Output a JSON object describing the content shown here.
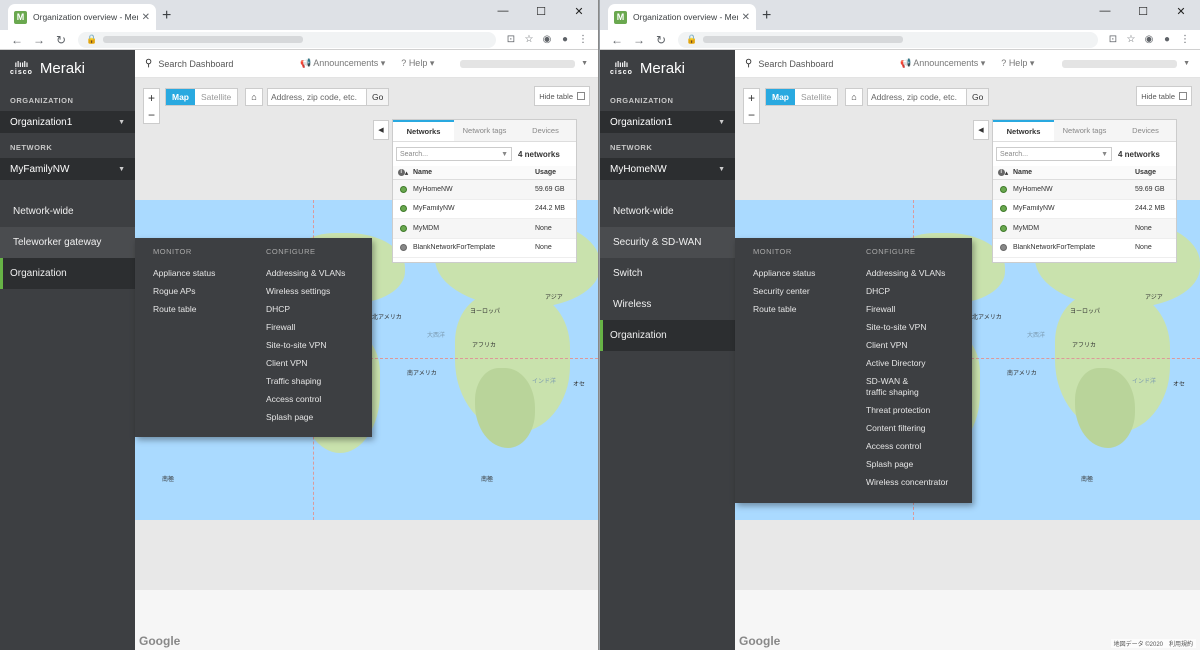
{
  "windows": [
    {
      "tab_title": "Organization overview - Meraki D",
      "favicon": "M",
      "window_controls": {
        "minimize": "—",
        "maximize": "☐",
        "close": "✕"
      },
      "org_label": "ORGANIZATION",
      "org_value": "Organization1",
      "net_label": "NETWORK",
      "net_value": "MyFamilyNW",
      "brand": "Meraki",
      "cisco": "cisco",
      "menu": [
        {
          "label": "Network-wide",
          "state": "normal"
        },
        {
          "label": "Teleworker gateway",
          "state": "hover"
        },
        {
          "label": "Organization",
          "state": "active"
        }
      ],
      "search_dashboard": "Search Dashboard",
      "announcements": "Announcements",
      "help": "Help",
      "map_btn": "Map",
      "satellite_btn": "Satellite",
      "address_placeholder": "Address, zip code, etc.",
      "go": "Go",
      "hide_table": "Hide table",
      "tabs": [
        "Networks",
        "Network tags",
        "Devices"
      ],
      "net_search": "Search...",
      "net_count": "4 networks",
      "col_name": "Name",
      "col_usage": "Usage",
      "networks": [
        {
          "name": "MyHomeNW",
          "usage": "59.69 GB",
          "status": "online"
        },
        {
          "name": "MyFamilyNW",
          "usage": "244.2 MB",
          "status": "online"
        },
        {
          "name": "MyMDM",
          "usage": "None",
          "status": "online"
        },
        {
          "name": "BlankNetworkForTemplate",
          "usage": "None",
          "status": "offline"
        }
      ],
      "flyout": {
        "monitor_title": "MONITOR",
        "configure_title": "CONFIGURE",
        "monitor": [
          "Appliance status",
          "Rogue APs",
          "Route table"
        ],
        "configure": [
          "Addressing & VLANs",
          "Wireless settings",
          "DHCP",
          "Firewall",
          "Site-to-site VPN",
          "Client VPN",
          "Traffic shaping",
          "Access control",
          "Splash page"
        ]
      },
      "map_labels": [
        "ヨーロッパ",
        "アジア",
        "アフリカ",
        "南アメリカ",
        "北アメリカ",
        "大西洋",
        "インド洋",
        "オセ",
        "南極"
      ],
      "google": "Google",
      "map_copyright": ""
    },
    {
      "tab_title": "Organization overview - Meraki D",
      "favicon": "M",
      "window_controls": {
        "minimize": "—",
        "maximize": "☐",
        "close": "✕"
      },
      "org_label": "ORGANIZATION",
      "org_value": "Organization1",
      "net_label": "NETWORK",
      "net_value": "MyHomeNW",
      "brand": "Meraki",
      "cisco": "cisco",
      "menu": [
        {
          "label": "Network-wide",
          "state": "normal"
        },
        {
          "label": "Security & SD-WAN",
          "state": "hover"
        },
        {
          "label": "Switch",
          "state": "normal"
        },
        {
          "label": "Wireless",
          "state": "normal"
        },
        {
          "label": "Organization",
          "state": "active"
        }
      ],
      "search_dashboard": "Search Dashboard",
      "announcements": "Announcements",
      "help": "Help",
      "map_btn": "Map",
      "satellite_btn": "Satellite",
      "address_placeholder": "Address, zip code, etc.",
      "go": "Go",
      "hide_table": "Hide table",
      "tabs": [
        "Networks",
        "Network tags",
        "Devices"
      ],
      "net_search": "Search...",
      "net_count": "4 networks",
      "col_name": "Name",
      "col_usage": "Usage",
      "networks": [
        {
          "name": "MyHomeNW",
          "usage": "59.69 GB",
          "status": "online"
        },
        {
          "name": "MyFamilyNW",
          "usage": "244.2 MB",
          "status": "online"
        },
        {
          "name": "MyMDM",
          "usage": "None",
          "status": "online"
        },
        {
          "name": "BlankNetworkForTemplate",
          "usage": "None",
          "status": "offline"
        }
      ],
      "flyout": {
        "monitor_title": "MONITOR",
        "configure_title": "CONFIGURE",
        "monitor": [
          "Appliance status",
          "Security center",
          "Route table"
        ],
        "configure": [
          "Addressing & VLANs",
          "DHCP",
          "Firewall",
          "Site-to-site VPN",
          "Client VPN",
          "Active Directory",
          "SD-WAN &\ntraffic shaping",
          "Threat protection",
          "Content filtering",
          "Access control",
          "Splash page",
          "Wireless concentrator"
        ]
      },
      "map_labels": [
        "ヨーロッパ",
        "アジア",
        "アフリカ",
        "南アメリカ",
        "北アメリカ",
        "大西洋",
        "インド洋",
        "オセ",
        "南極"
      ],
      "google": "Google",
      "map_copyright": "地図データ ©2020　利用規約"
    }
  ]
}
